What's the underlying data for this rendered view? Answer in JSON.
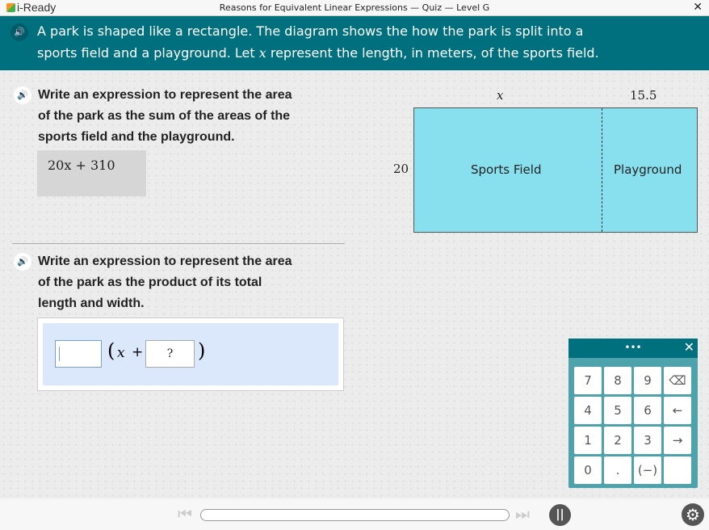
{
  "window": {
    "logo": "i-Ready",
    "title": "Reasons for Equivalent Linear Expressions — Quiz — Level G",
    "close": "✕"
  },
  "banner": {
    "line1": "A park is shaped like a rectangle. The diagram shows the how the park is split into a",
    "line2_a": "sports field and a playground. Let ",
    "var": "x",
    "line2_b": " represent the length, in meters, of the sports field."
  },
  "question1": {
    "lines": [
      "Write an expression to represent the area",
      "of the park as the sum of the areas of the",
      "sports field and the playground."
    ],
    "answer": "20x + 310"
  },
  "question2": {
    "lines": [
      "Write an expression to represent the area",
      "of the park as the product of its total",
      "length and width."
    ],
    "expr_open": "(",
    "expr_var": "x",
    "expr_plus": "+",
    "box2_placeholder": "?",
    "expr_close": ")"
  },
  "diagram": {
    "top_left": "x",
    "top_right": "15.5",
    "side": "20",
    "left_region": "Sports Field",
    "right_region": "Playground",
    "fill": "#88e0ee"
  },
  "keypad": {
    "handle": "•••",
    "close": "✕",
    "keys": [
      "7",
      "8",
      "9",
      "⌫",
      "4",
      "5",
      "6",
      "←",
      "1",
      "2",
      "3",
      "→",
      "0",
      ".",
      "(−)",
      ""
    ]
  },
  "colors": {
    "accent": "#00707f"
  }
}
